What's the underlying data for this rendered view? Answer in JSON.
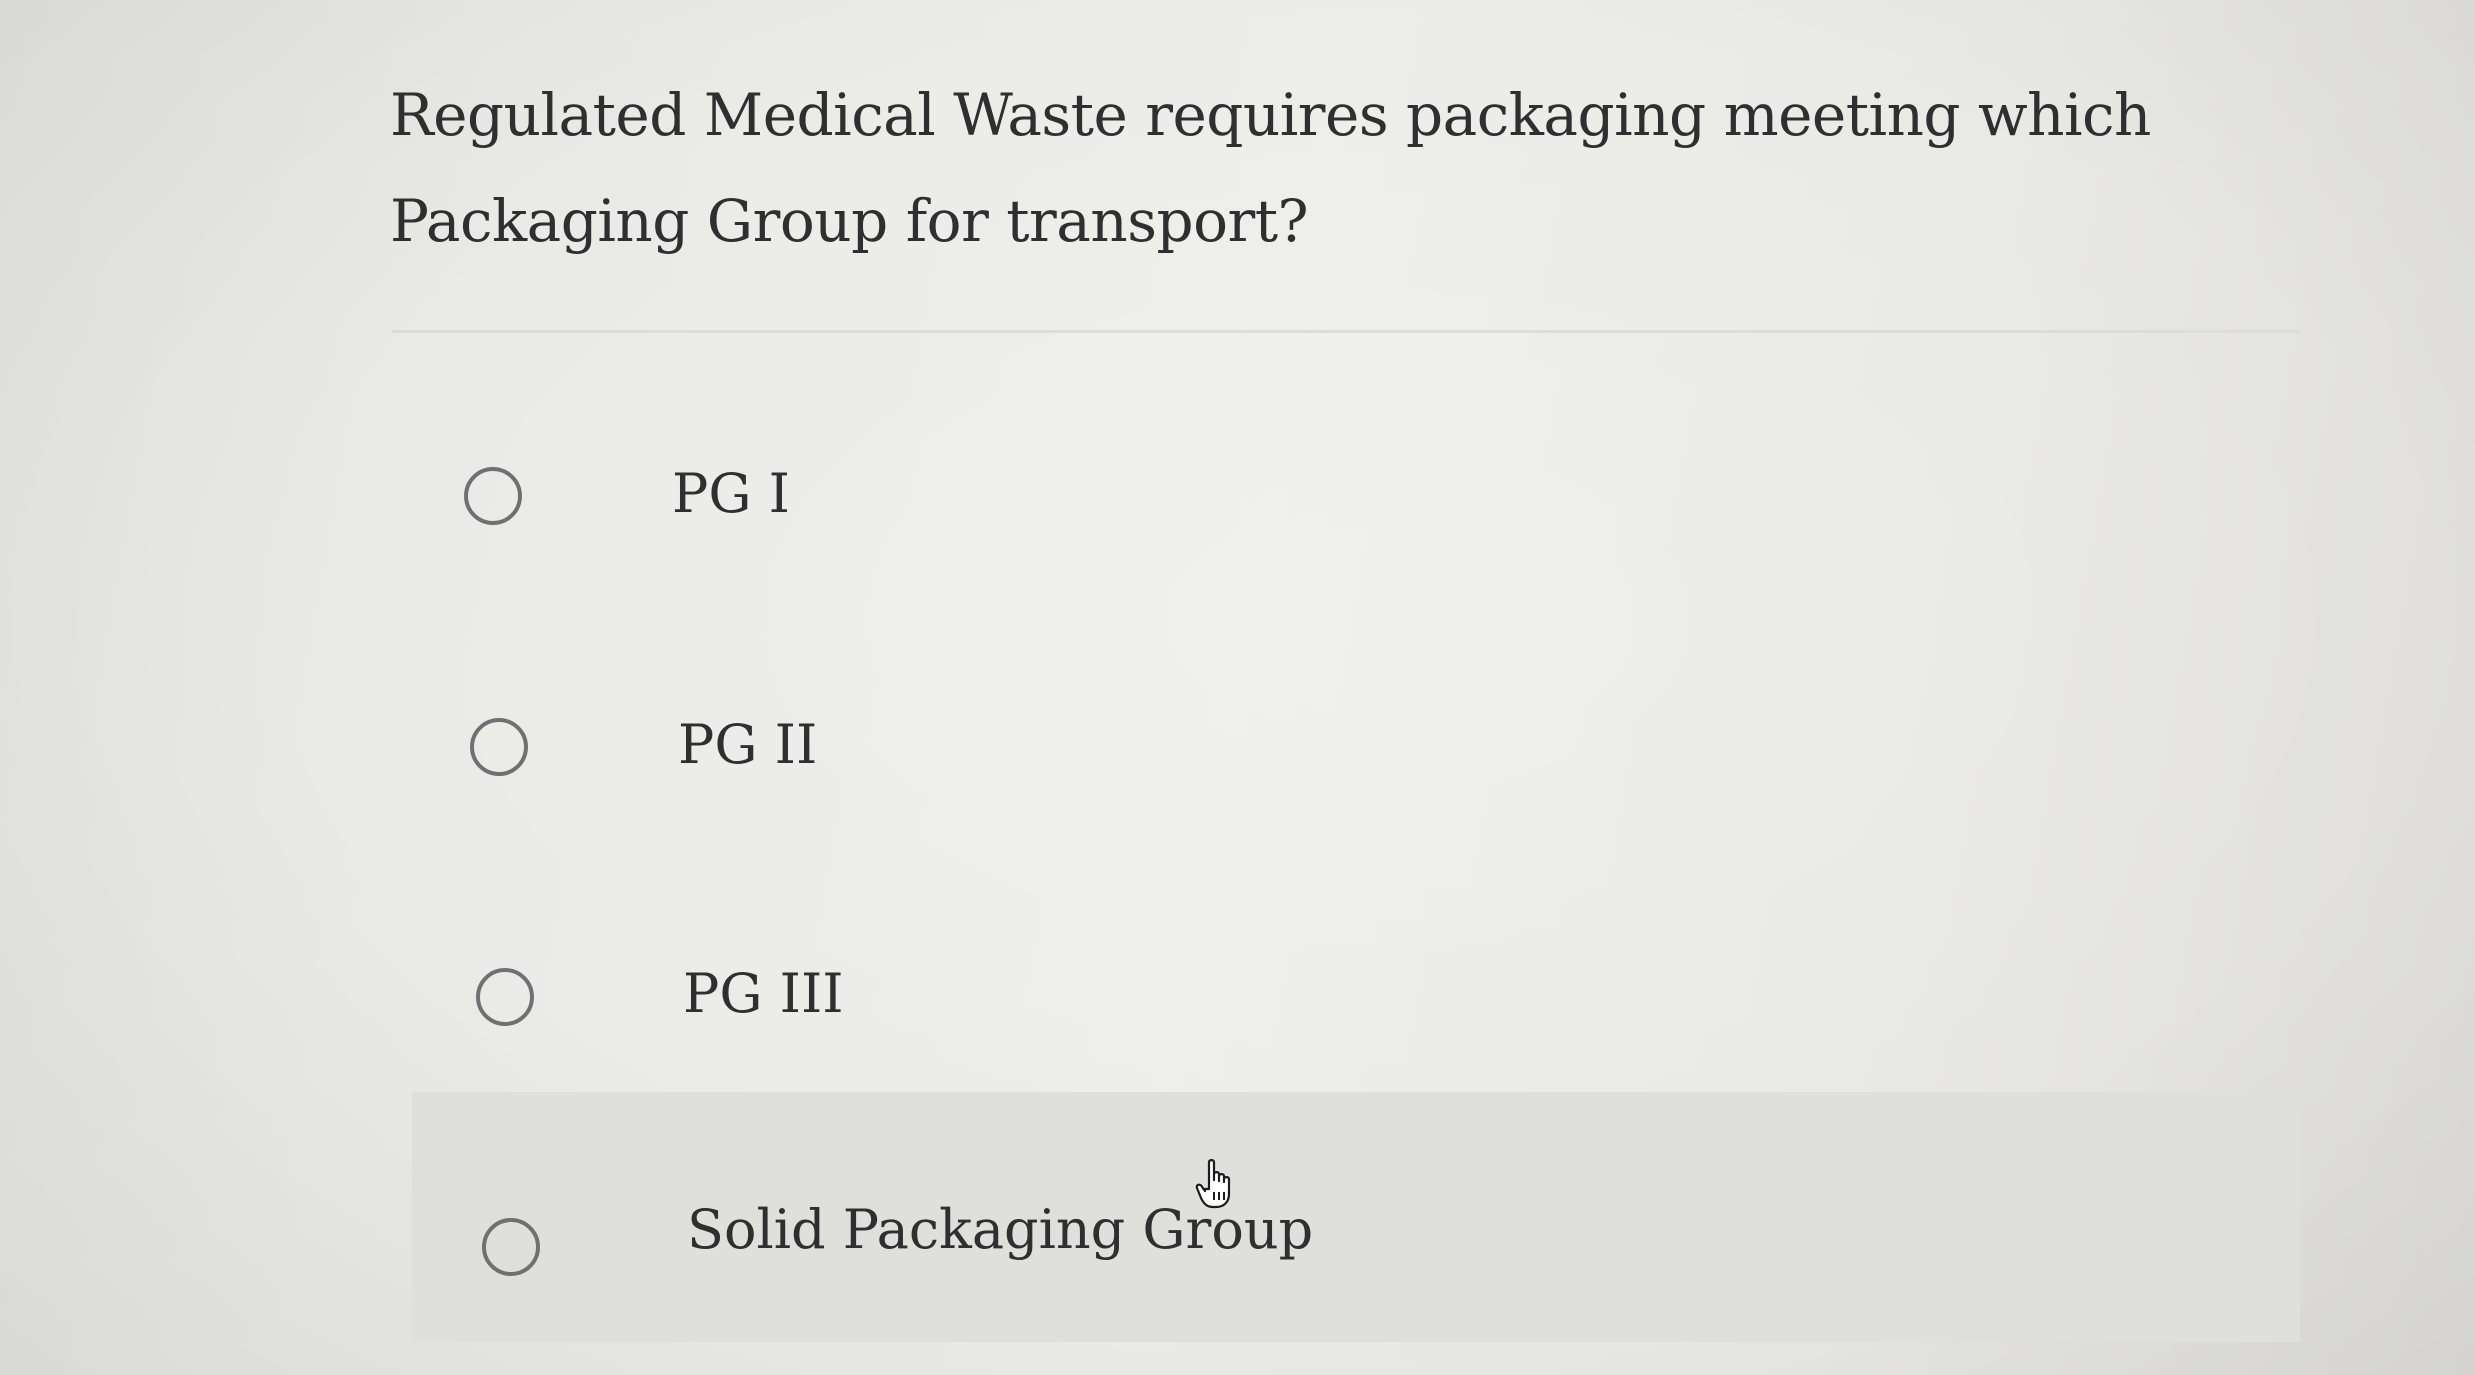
{
  "question": {
    "text": "Regulated Medical Waste requires packaging meeting which Packaging Group for transport?"
  },
  "options": [
    {
      "label": "PG I",
      "selected": false
    },
    {
      "label": "PG II",
      "selected": false
    },
    {
      "label": "PG III",
      "selected": false
    },
    {
      "label": "Solid Packaging Group",
      "selected": false,
      "hovered": true
    }
  ],
  "cursor": {
    "icon": "hand-pointer-icon"
  },
  "colors": {
    "text": "#2f2f31",
    "radio_border": "#707072",
    "hover_background": "#dfdfdc",
    "divider": "#dcdcd9"
  }
}
